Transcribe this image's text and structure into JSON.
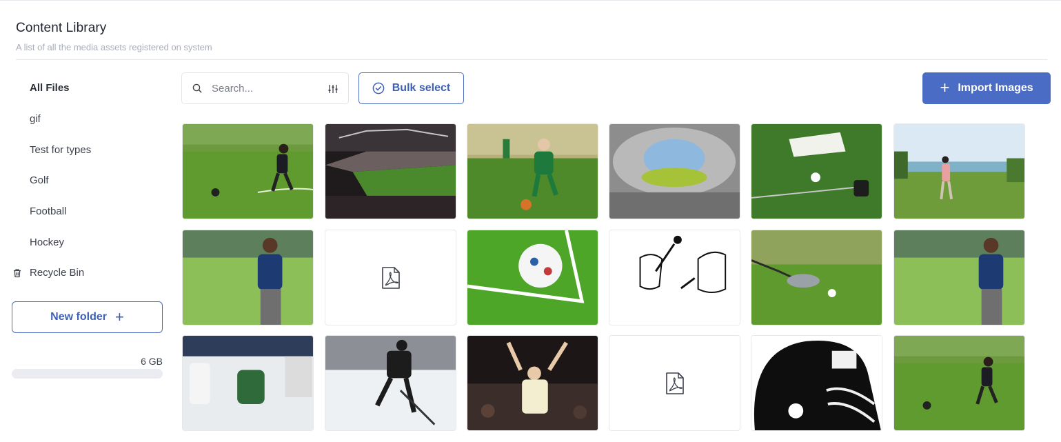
{
  "header": {
    "title": "Content Library",
    "subtitle": "A list of all the media assets registered on system"
  },
  "sidebar": {
    "items": [
      {
        "label": "All Files",
        "active": true
      },
      {
        "label": "gif"
      },
      {
        "label": "Test for types"
      },
      {
        "label": "Golf"
      },
      {
        "label": "Football"
      },
      {
        "label": "Hockey"
      }
    ],
    "recycle_bin": {
      "label": "Recycle Bin",
      "icon": "trash-icon"
    },
    "new_folder": {
      "label": "New folder",
      "icon": "plus-icon"
    },
    "storage": {
      "label": "6 GB",
      "used_fraction": 0
    }
  },
  "toolbar": {
    "search": {
      "placeholder": "Search...",
      "value": "",
      "icon": "search-icon",
      "filter_icon": "sliders-icon"
    },
    "bulk_select": {
      "label": "Bulk select",
      "icon": "check-circle-icon"
    },
    "import": {
      "label": "Import Images",
      "icon": "plus-icon"
    }
  },
  "colors": {
    "accent": "#4a6cc5",
    "accent_border": "#4a6cc0",
    "muted_text": "#a9adb8",
    "storage_track": "#eaecf1"
  },
  "assets": [
    {
      "kind": "image",
      "subject": "child kicking ball on grass field",
      "icon": "photo-thumbnail"
    },
    {
      "kind": "image",
      "subject": "stadium crowd night match",
      "icon": "photo-thumbnail"
    },
    {
      "kind": "image",
      "subject": "boy in green kit kicking ball",
      "icon": "photo-thumbnail"
    },
    {
      "kind": "image",
      "subject": "stadium roof aerial",
      "icon": "photo-thumbnail"
    },
    {
      "kind": "image",
      "subject": "golf glove ball and putter on grass",
      "icon": "photo-thumbnail"
    },
    {
      "kind": "image",
      "subject": "golfer swinging on course",
      "icon": "photo-thumbnail"
    },
    {
      "kind": "image",
      "subject": "golfer walking on course",
      "icon": "photo-thumbnail"
    },
    {
      "kind": "pdf",
      "icon": "pdf-file-icon"
    },
    {
      "kind": "image",
      "subject": "soccer ball at corner line",
      "icon": "photo-thumbnail"
    },
    {
      "kind": "image",
      "subject": "cartoon cats playing golf",
      "icon": "photo-thumbnail"
    },
    {
      "kind": "image",
      "subject": "golf club and tee on grass",
      "icon": "photo-thumbnail"
    },
    {
      "kind": "image",
      "subject": "golfer walking on course",
      "icon": "photo-thumbnail"
    },
    {
      "kind": "image",
      "subject": "hockey goalie save",
      "icon": "photo-thumbnail"
    },
    {
      "kind": "image",
      "subject": "hockey player skating",
      "icon": "photo-thumbnail"
    },
    {
      "kind": "image",
      "subject": "fan cheering in crowd",
      "icon": "photo-thumbnail"
    },
    {
      "kind": "pdf",
      "icon": "pdf-file-icon"
    },
    {
      "kind": "image",
      "subject": "football helmet graphic",
      "icon": "photo-thumbnail"
    },
    {
      "kind": "image",
      "subject": "child kicking ball on grass field",
      "icon": "photo-thumbnail"
    }
  ]
}
